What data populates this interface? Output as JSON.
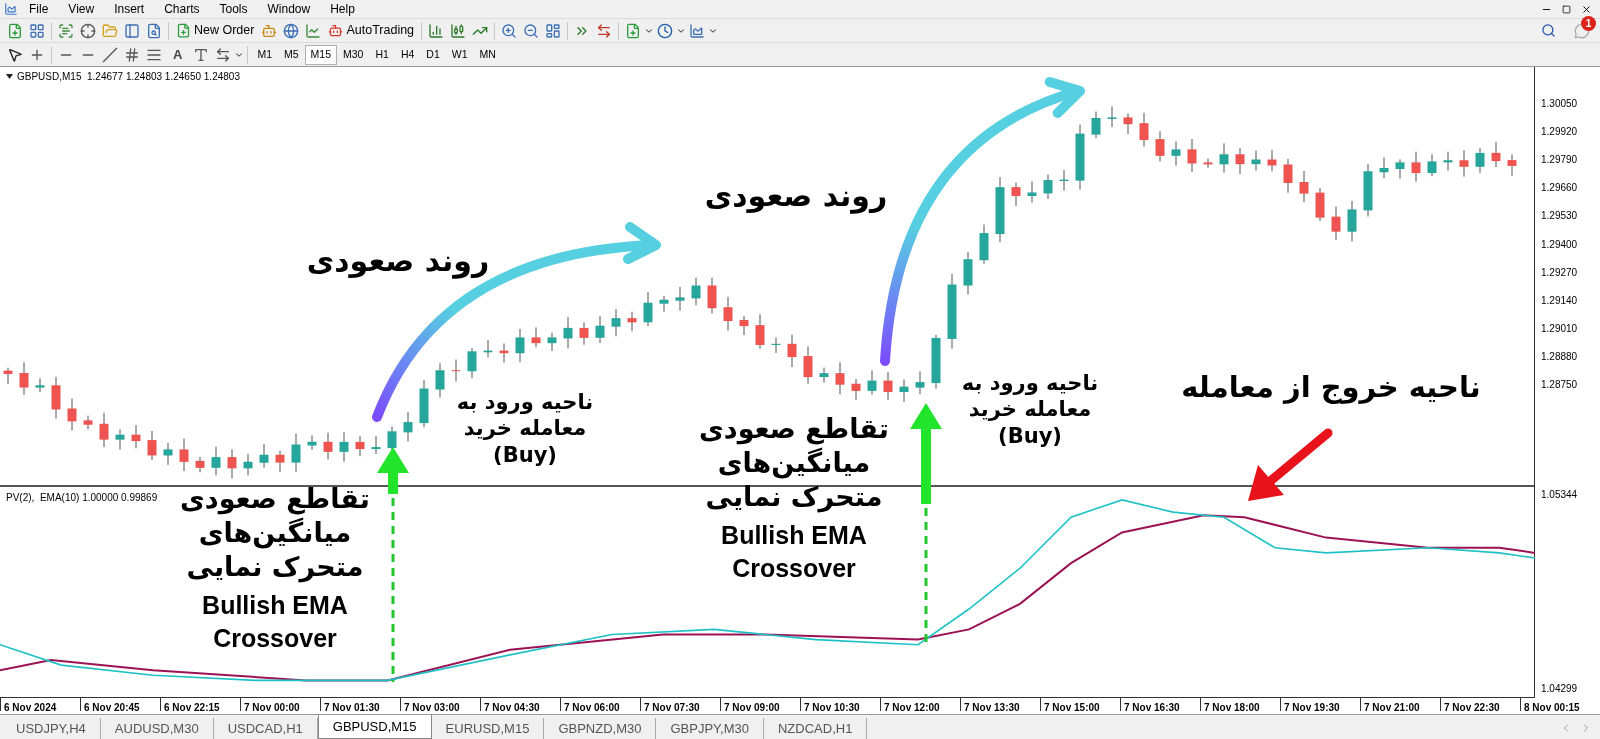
{
  "menu": [
    "File",
    "View",
    "Insert",
    "Charts",
    "Tools",
    "Window",
    "Help"
  ],
  "toolbar": {
    "new_order": "New Order",
    "autotrading": "AutoTrading",
    "text_tool": "A"
  },
  "timeframes": [
    {
      "label": "M1",
      "selected": false
    },
    {
      "label": "M5",
      "selected": false
    },
    {
      "label": "M15",
      "selected": true
    },
    {
      "label": "M30",
      "selected": false
    },
    {
      "label": "H1",
      "selected": false
    },
    {
      "label": "H4",
      "selected": false
    },
    {
      "label": "D1",
      "selected": false
    },
    {
      "label": "W1",
      "selected": false
    },
    {
      "label": "MN",
      "selected": false
    }
  ],
  "notifications": {
    "badge": "1"
  },
  "chart": {
    "header": "GBPUSD,M15  1.24677 1.24803 1.24650 1.24803",
    "price_labels": [
      "1.30050",
      "1.29920",
      "1.29790",
      "1.29660",
      "1.29530",
      "1.29400",
      "1.29270",
      "1.29140",
      "1.29010",
      "1.28880",
      "1.28750"
    ],
    "indicator_header": "PV(2),  EMA(10) 1.00000 0.99869",
    "indicator_labels": [
      "1.05344",
      "1.04299"
    ],
    "time_labels": [
      "6 Nov 2024",
      "6 Nov 20:45",
      "6 Nov 22:15",
      "7 Nov 00:00",
      "7 Nov 01:30",
      "7 Nov 03:00",
      "7 Nov 04:30",
      "7 Nov 06:00",
      "7 Nov 07:30",
      "7 Nov 09:00",
      "7 Nov 10:30",
      "7 Nov 12:00",
      "7 Nov 13:30",
      "7 Nov 15:00",
      "7 Nov 16:30",
      "7 Nov 18:00",
      "7 Nov 19:30",
      "7 Nov 21:00",
      "7 Nov 22:30",
      "8 Nov 00:15"
    ]
  },
  "annotations": [
    {
      "kind": "trend",
      "lines": [
        "روند صعودی"
      ]
    },
    {
      "kind": "trend",
      "lines": [
        "روند صعودی"
      ]
    },
    {
      "kind": "exit",
      "lines": [
        "ناحیه خروج از معامله"
      ]
    },
    {
      "kind": "entry",
      "lines": [
        "ناحیه ورود به",
        "معامله خرید",
        "(Buy)"
      ]
    },
    {
      "kind": "entry",
      "lines": [
        "ناحیه ورود به",
        "معامله خرید",
        "(Buy)"
      ]
    },
    {
      "kind": "crossover",
      "lines": [
        "تقاطع صعودی",
        "میانگین‌های",
        "متحرک نمایی"
      ],
      "english_lines": [
        "Bullish EMA",
        "Crossover"
      ]
    },
    {
      "kind": "crossover",
      "lines": [
        "تقاطع صعودی",
        "میانگین‌های",
        "متحرک نمایی"
      ],
      "english_lines": [
        "Bullish EMA",
        "Crossover"
      ]
    }
  ],
  "tabs": [
    {
      "label": "USDJPY,H4",
      "selected": false
    },
    {
      "label": "AUDUSD,M30",
      "selected": false
    },
    {
      "label": "USDCAD,H1",
      "selected": false
    },
    {
      "label": "GBPUSD,M15",
      "selected": true
    },
    {
      "label": "EURUSD,M15",
      "selected": false
    },
    {
      "label": "GBPNZD,M30",
      "selected": false
    },
    {
      "label": "GBPJPY,M30",
      "selected": false
    },
    {
      "label": "NZDCAD,H1",
      "selected": false
    }
  ]
}
